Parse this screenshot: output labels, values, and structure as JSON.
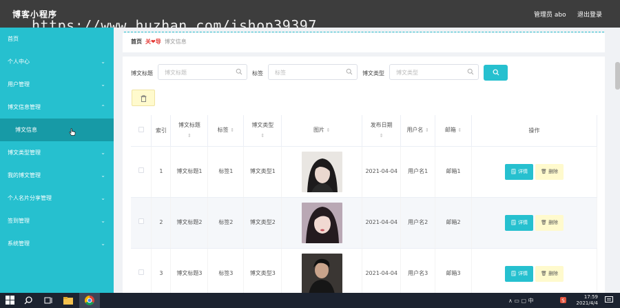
{
  "header": {
    "app_title": "博客小程序",
    "watermark": "https://www.huzhan.com/ishop39397",
    "admin_label": "管理员 abo",
    "logout_label": "退出登录"
  },
  "sidebar": {
    "items": [
      {
        "label": "首页"
      },
      {
        "label": "个人中心",
        "chev": "⌄"
      },
      {
        "label": "用户管理",
        "chev": "⌄"
      },
      {
        "label": "博文信息管理",
        "chev": "⌃"
      },
      {
        "label": "博文信息"
      },
      {
        "label": "博文类型管理",
        "chev": "⌄"
      },
      {
        "label": "我的博文管理",
        "chev": "⌄"
      },
      {
        "label": "个人名片分享管理",
        "chev": "⌄"
      },
      {
        "label": "签到管理",
        "chev": "⌄"
      },
      {
        "label": "系统管理",
        "chev": "⌄"
      }
    ]
  },
  "breadcrumb": {
    "home": "首页",
    "sep": "关❤导",
    "current": "博文信息"
  },
  "search": {
    "title_label": "博文标题",
    "title_placeholder": "博文标题",
    "tag_label": "标签",
    "tag_placeholder": "标签",
    "type_label": "博文类型",
    "type_placeholder": "博文类型"
  },
  "table": {
    "headers": {
      "index": "索引",
      "title": "博文标题",
      "tag": "标签",
      "type": "博文类型",
      "image": "图片",
      "date": "发布日期",
      "user": "用户名",
      "email": "邮箱",
      "actions": "操作"
    },
    "sort_glyph": "⇕",
    "rows": [
      {
        "index": "1",
        "title": "博文标题1",
        "tag": "标签1",
        "type": "博文类型1",
        "date": "2021-04-04",
        "user": "用户名1",
        "email": "邮箱1"
      },
      {
        "index": "2",
        "title": "博文标题2",
        "tag": "标签2",
        "type": "博文类型2",
        "date": "2021-04-04",
        "user": "用户名2",
        "email": "邮箱2"
      },
      {
        "index": "3",
        "title": "博文标题3",
        "tag": "标签3",
        "type": "博文类型3",
        "date": "2021-04-04",
        "user": "用户名3",
        "email": "邮箱3"
      }
    ],
    "detail_label": "详情",
    "delete_label": "删除"
  },
  "taskbar": {
    "tray_text": "∧ ▭ ▢ 中",
    "time": "17:59",
    "date": "2021/4/4"
  },
  "colors": {
    "accent": "#26c0cf",
    "sidebar_active": "#179aa6",
    "topbar": "#3d3d3d",
    "delete_bg": "#fffacd"
  }
}
